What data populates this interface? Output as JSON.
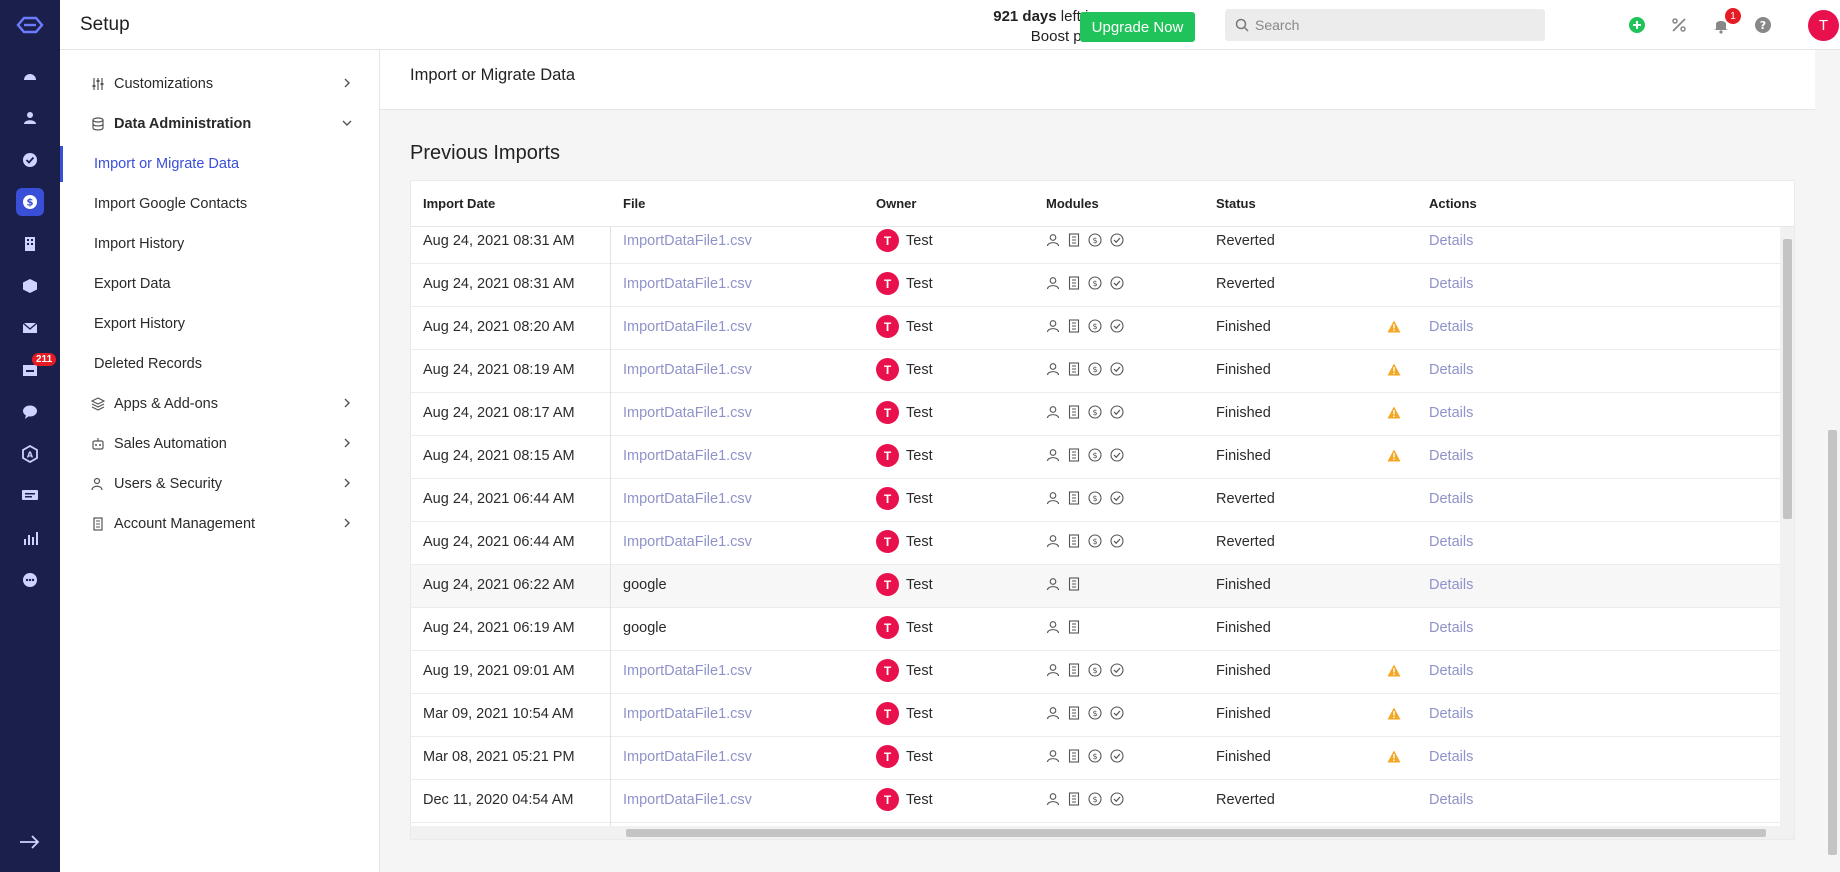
{
  "header": {
    "title": "Setup",
    "trial_days": "921 days",
    "trial_rest_line1": " left in your",
    "trial_line2": "Boost plan trial",
    "upgrade_label": "Upgrade Now",
    "search_placeholder": "Search",
    "notification_count": "1",
    "avatar_initial": "T"
  },
  "rail": {
    "inbox_badge": "211",
    "icons": [
      "dashboard-icon",
      "contacts-icon",
      "tasks-icon",
      "deals-icon",
      "accounts-icon",
      "products-icon",
      "email-icon",
      "inbox-icon",
      "chat-icon",
      "automation-icon",
      "messages-icon",
      "reports-icon",
      "more-icon"
    ]
  },
  "sidebar": {
    "items": [
      {
        "label": "Customizations",
        "icon": "sliders-icon"
      },
      {
        "label": "Data Administration",
        "icon": "database-icon"
      },
      {
        "label": "Import or Migrate Data"
      },
      {
        "label": "Import Google Contacts"
      },
      {
        "label": "Import History"
      },
      {
        "label": "Export Data"
      },
      {
        "label": "Export History"
      },
      {
        "label": "Deleted Records"
      },
      {
        "label": "Apps & Add-ons",
        "icon": "layers-icon"
      },
      {
        "label": "Sales Automation",
        "icon": "robot-icon"
      },
      {
        "label": "Users & Security",
        "icon": "user-shield-icon"
      },
      {
        "label": "Account Management",
        "icon": "building-icon"
      }
    ]
  },
  "main": {
    "card_title": "Import or Migrate Data",
    "section_title": "Previous Imports",
    "columns": {
      "date": "Import Date",
      "file": "File",
      "owner": "Owner",
      "modules": "Modules",
      "status": "Status",
      "actions": "Actions"
    },
    "rows": [
      {
        "date": "Aug 24, 2021 08:31 AM",
        "file": "ImportDataFile1.csv",
        "owner": "Test",
        "avatar": "T",
        "status": "Reverted",
        "warn": false,
        "action": "Details",
        "mods": 4
      },
      {
        "date": "Aug 24, 2021 08:31 AM",
        "file": "ImportDataFile1.csv",
        "owner": "Test",
        "avatar": "T",
        "status": "Reverted",
        "warn": false,
        "action": "Details",
        "mods": 4
      },
      {
        "date": "Aug 24, 2021 08:20 AM",
        "file": "ImportDataFile1.csv",
        "owner": "Test",
        "avatar": "T",
        "status": "Finished",
        "warn": true,
        "action": "Details",
        "mods": 4
      },
      {
        "date": "Aug 24, 2021 08:19 AM",
        "file": "ImportDataFile1.csv",
        "owner": "Test",
        "avatar": "T",
        "status": "Finished",
        "warn": true,
        "action": "Details",
        "mods": 4
      },
      {
        "date": "Aug 24, 2021 08:17 AM",
        "file": "ImportDataFile1.csv",
        "owner": "Test",
        "avatar": "T",
        "status": "Finished",
        "warn": true,
        "action": "Details",
        "mods": 4
      },
      {
        "date": "Aug 24, 2021 08:15 AM",
        "file": "ImportDataFile1.csv",
        "owner": "Test",
        "avatar": "T",
        "status": "Finished",
        "warn": true,
        "action": "Details",
        "mods": 4
      },
      {
        "date": "Aug 24, 2021 06:44 AM",
        "file": "ImportDataFile1.csv",
        "owner": "Test",
        "avatar": "T",
        "status": "Reverted",
        "warn": false,
        "action": "Details",
        "mods": 4
      },
      {
        "date": "Aug 24, 2021 06:44 AM",
        "file": "ImportDataFile1.csv",
        "owner": "Test",
        "avatar": "T",
        "status": "Reverted",
        "warn": false,
        "action": "Details",
        "mods": 4
      },
      {
        "date": "Aug 24, 2021 06:22 AM",
        "file": "google",
        "owner": "Test",
        "avatar": "T",
        "status": "Finished",
        "warn": false,
        "action": "Details",
        "mods": 2
      },
      {
        "date": "Aug 24, 2021 06:19 AM",
        "file": "google",
        "owner": "Test",
        "avatar": "T",
        "status": "Finished",
        "warn": false,
        "action": "Details",
        "mods": 2
      },
      {
        "date": "Aug 19, 2021 09:01 AM",
        "file": "ImportDataFile1.csv",
        "owner": "Test",
        "avatar": "T",
        "status": "Finished",
        "warn": true,
        "action": "Details",
        "mods": 4
      },
      {
        "date": "Mar 09, 2021 10:54 AM",
        "file": "ImportDataFile1.csv",
        "owner": "Test",
        "avatar": "T",
        "status": "Finished",
        "warn": true,
        "action": "Details",
        "mods": 4
      },
      {
        "date": "Mar 08, 2021 05:21 PM",
        "file": "ImportDataFile1.csv",
        "owner": "Test",
        "avatar": "T",
        "status": "Finished",
        "warn": true,
        "action": "Details",
        "mods": 4
      },
      {
        "date": "Dec 11, 2020 04:54 AM",
        "file": "ImportDataFile1.csv",
        "owner": "Test",
        "avatar": "T",
        "status": "Reverted",
        "warn": false,
        "action": "Details",
        "mods": 4
      }
    ]
  },
  "colors": {
    "rail": "#1b1f4b",
    "accent": "#3a4fd8",
    "upgrade": "#20c35a",
    "avatar": "#e8114d",
    "link": "#8f92c9",
    "warning": "#f5a623"
  }
}
